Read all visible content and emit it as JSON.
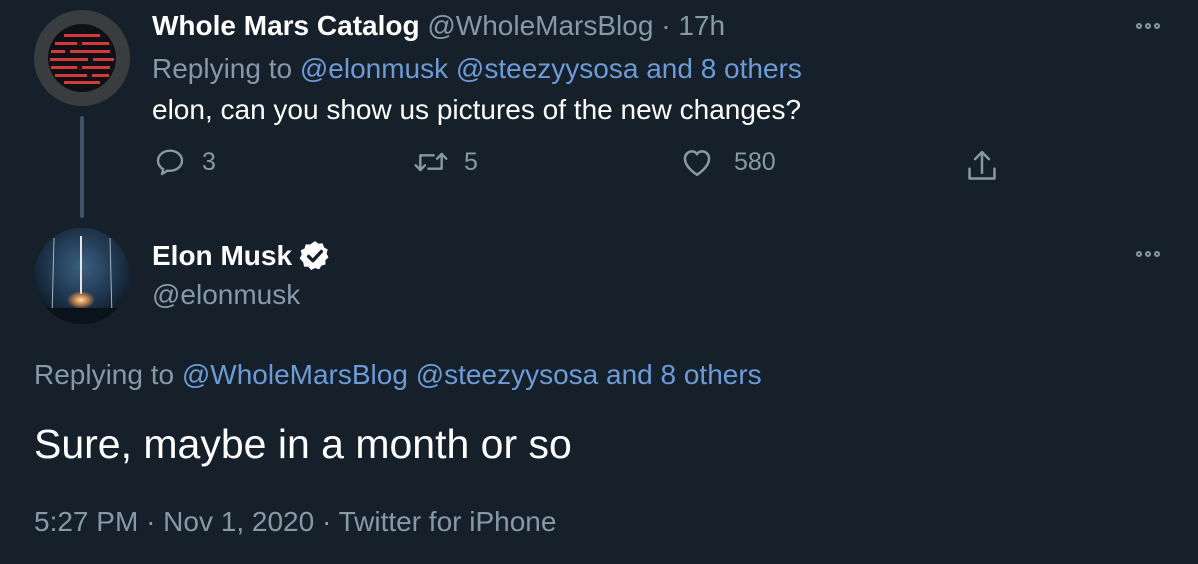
{
  "parent_tweet": {
    "author_name": "Whole Mars Catalog",
    "handle": "@WholeMarsBlog",
    "separator": "·",
    "time": "17h",
    "replying_prefix": "Replying to",
    "replying_to": [
      "@elonmusk",
      "@steezyysosa"
    ],
    "replying_others": "and 8 others",
    "text": "elon, can you show us pictures of the new changes?",
    "reply_count": "3",
    "retweet_count": "5",
    "like_count": "580"
  },
  "main_tweet": {
    "author_name": "Elon Musk",
    "handle": "@elonmusk",
    "replying_prefix": "Replying to",
    "replying_to": [
      "@WholeMarsBlog",
      "@steezyysosa"
    ],
    "replying_others": "and 8 others",
    "text": "Sure, maybe in a month or so",
    "time": "5:27 PM",
    "date": "Nov 1, 2020",
    "source": "Twitter for iPhone",
    "meta_separator": "·"
  },
  "icons": {
    "reply": "reply-icon",
    "retweet": "retweet-icon",
    "like": "heart-icon",
    "share": "share-icon",
    "more": "more-icon",
    "verified": "verified-badge-icon"
  },
  "colors": {
    "background": "#15202b",
    "link": "#6c9bd6",
    "muted": "#8899a6",
    "thread_line": "#3d5466",
    "avatar_logo_red": "#c0392b"
  }
}
